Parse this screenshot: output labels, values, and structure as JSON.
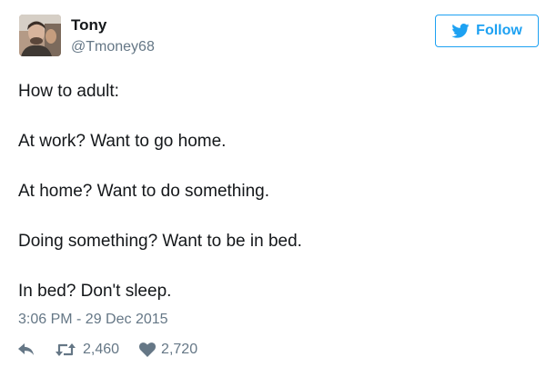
{
  "user": {
    "name": "Tony",
    "handle": "@Tmoney68"
  },
  "follow": {
    "label": "Follow",
    "icon": "twitter-bird-icon"
  },
  "tweet": {
    "lines": [
      "How to adult:",
      "At work? Want to go home.",
      "At home? Want to do something.",
      "Doing something? Want to be in bed.",
      "In bed? Don't sleep."
    ],
    "timestamp": "3:06 PM - 29 Dec 2015"
  },
  "actions": {
    "reply_icon": "reply-icon",
    "retweet_icon": "retweet-icon",
    "retweet_count": "2,460",
    "like_icon": "heart-icon",
    "like_count": "2,720"
  },
  "colors": {
    "accent": "#1da1f2",
    "text": "#14171a",
    "secondary": "#657786"
  }
}
